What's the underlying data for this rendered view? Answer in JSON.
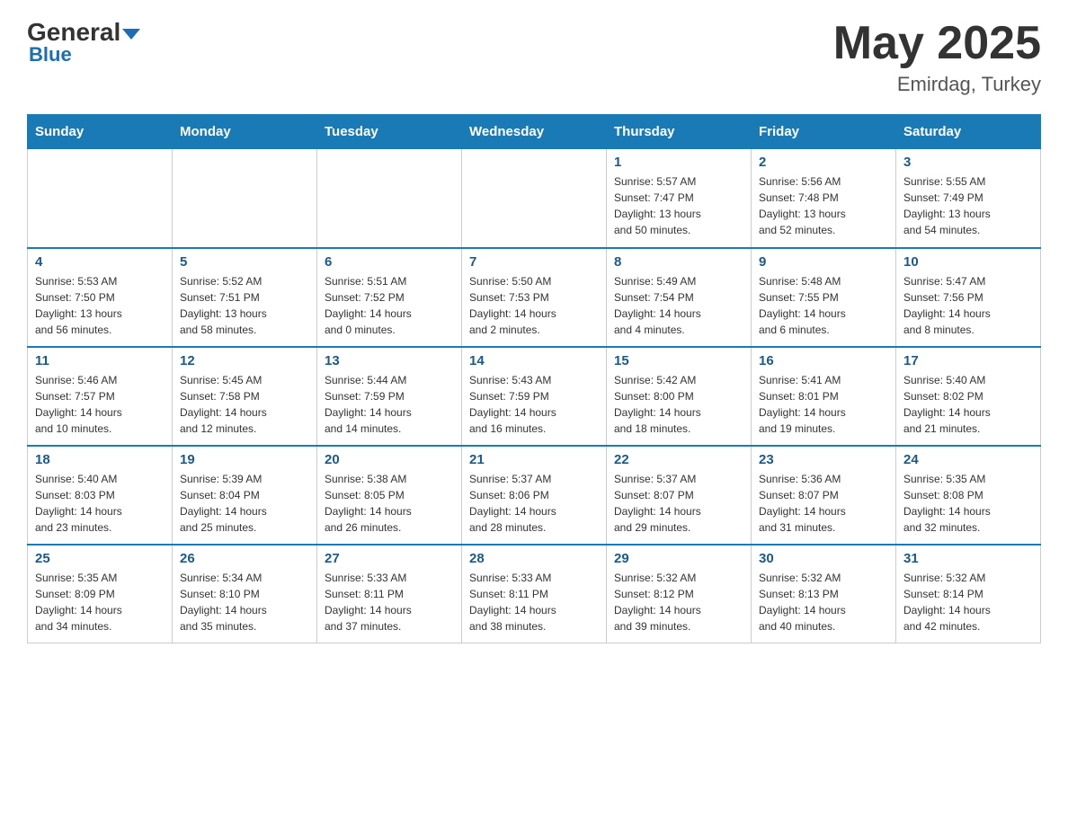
{
  "header": {
    "logo_general": "General",
    "logo_blue": "Blue",
    "month_year": "May 2025",
    "location": "Emirdag, Turkey"
  },
  "days_of_week": [
    "Sunday",
    "Monday",
    "Tuesday",
    "Wednesday",
    "Thursday",
    "Friday",
    "Saturday"
  ],
  "weeks": [
    {
      "days": [
        {
          "number": "",
          "info": ""
        },
        {
          "number": "",
          "info": ""
        },
        {
          "number": "",
          "info": ""
        },
        {
          "number": "",
          "info": ""
        },
        {
          "number": "1",
          "info": "Sunrise: 5:57 AM\nSunset: 7:47 PM\nDaylight: 13 hours\nand 50 minutes."
        },
        {
          "number": "2",
          "info": "Sunrise: 5:56 AM\nSunset: 7:48 PM\nDaylight: 13 hours\nand 52 minutes."
        },
        {
          "number": "3",
          "info": "Sunrise: 5:55 AM\nSunset: 7:49 PM\nDaylight: 13 hours\nand 54 minutes."
        }
      ]
    },
    {
      "days": [
        {
          "number": "4",
          "info": "Sunrise: 5:53 AM\nSunset: 7:50 PM\nDaylight: 13 hours\nand 56 minutes."
        },
        {
          "number": "5",
          "info": "Sunrise: 5:52 AM\nSunset: 7:51 PM\nDaylight: 13 hours\nand 58 minutes."
        },
        {
          "number": "6",
          "info": "Sunrise: 5:51 AM\nSunset: 7:52 PM\nDaylight: 14 hours\nand 0 minutes."
        },
        {
          "number": "7",
          "info": "Sunrise: 5:50 AM\nSunset: 7:53 PM\nDaylight: 14 hours\nand 2 minutes."
        },
        {
          "number": "8",
          "info": "Sunrise: 5:49 AM\nSunset: 7:54 PM\nDaylight: 14 hours\nand 4 minutes."
        },
        {
          "number": "9",
          "info": "Sunrise: 5:48 AM\nSunset: 7:55 PM\nDaylight: 14 hours\nand 6 minutes."
        },
        {
          "number": "10",
          "info": "Sunrise: 5:47 AM\nSunset: 7:56 PM\nDaylight: 14 hours\nand 8 minutes."
        }
      ]
    },
    {
      "days": [
        {
          "number": "11",
          "info": "Sunrise: 5:46 AM\nSunset: 7:57 PM\nDaylight: 14 hours\nand 10 minutes."
        },
        {
          "number": "12",
          "info": "Sunrise: 5:45 AM\nSunset: 7:58 PM\nDaylight: 14 hours\nand 12 minutes."
        },
        {
          "number": "13",
          "info": "Sunrise: 5:44 AM\nSunset: 7:59 PM\nDaylight: 14 hours\nand 14 minutes."
        },
        {
          "number": "14",
          "info": "Sunrise: 5:43 AM\nSunset: 7:59 PM\nDaylight: 14 hours\nand 16 minutes."
        },
        {
          "number": "15",
          "info": "Sunrise: 5:42 AM\nSunset: 8:00 PM\nDaylight: 14 hours\nand 18 minutes."
        },
        {
          "number": "16",
          "info": "Sunrise: 5:41 AM\nSunset: 8:01 PM\nDaylight: 14 hours\nand 19 minutes."
        },
        {
          "number": "17",
          "info": "Sunrise: 5:40 AM\nSunset: 8:02 PM\nDaylight: 14 hours\nand 21 minutes."
        }
      ]
    },
    {
      "days": [
        {
          "number": "18",
          "info": "Sunrise: 5:40 AM\nSunset: 8:03 PM\nDaylight: 14 hours\nand 23 minutes."
        },
        {
          "number": "19",
          "info": "Sunrise: 5:39 AM\nSunset: 8:04 PM\nDaylight: 14 hours\nand 25 minutes."
        },
        {
          "number": "20",
          "info": "Sunrise: 5:38 AM\nSunset: 8:05 PM\nDaylight: 14 hours\nand 26 minutes."
        },
        {
          "number": "21",
          "info": "Sunrise: 5:37 AM\nSunset: 8:06 PM\nDaylight: 14 hours\nand 28 minutes."
        },
        {
          "number": "22",
          "info": "Sunrise: 5:37 AM\nSunset: 8:07 PM\nDaylight: 14 hours\nand 29 minutes."
        },
        {
          "number": "23",
          "info": "Sunrise: 5:36 AM\nSunset: 8:07 PM\nDaylight: 14 hours\nand 31 minutes."
        },
        {
          "number": "24",
          "info": "Sunrise: 5:35 AM\nSunset: 8:08 PM\nDaylight: 14 hours\nand 32 minutes."
        }
      ]
    },
    {
      "days": [
        {
          "number": "25",
          "info": "Sunrise: 5:35 AM\nSunset: 8:09 PM\nDaylight: 14 hours\nand 34 minutes."
        },
        {
          "number": "26",
          "info": "Sunrise: 5:34 AM\nSunset: 8:10 PM\nDaylight: 14 hours\nand 35 minutes."
        },
        {
          "number": "27",
          "info": "Sunrise: 5:33 AM\nSunset: 8:11 PM\nDaylight: 14 hours\nand 37 minutes."
        },
        {
          "number": "28",
          "info": "Sunrise: 5:33 AM\nSunset: 8:11 PM\nDaylight: 14 hours\nand 38 minutes."
        },
        {
          "number": "29",
          "info": "Sunrise: 5:32 AM\nSunset: 8:12 PM\nDaylight: 14 hours\nand 39 minutes."
        },
        {
          "number": "30",
          "info": "Sunrise: 5:32 AM\nSunset: 8:13 PM\nDaylight: 14 hours\nand 40 minutes."
        },
        {
          "number": "31",
          "info": "Sunrise: 5:32 AM\nSunset: 8:14 PM\nDaylight: 14 hours\nand 42 minutes."
        }
      ]
    }
  ]
}
